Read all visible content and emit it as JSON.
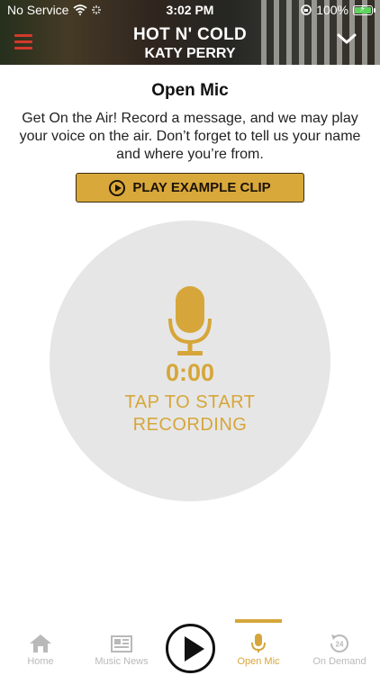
{
  "status_bar": {
    "carrier": "No Service",
    "time": "3:02 PM",
    "battery": "100%",
    "battery_level": 1.0
  },
  "now_playing": {
    "title": "HOT N' COLD",
    "artist": "KATY PERRY",
    "menu_icon": "hamburger-icon",
    "collapse_icon": "chevron-down-icon"
  },
  "open_mic": {
    "title": "Open Mic",
    "intro": "Get On the Air!  Record a message, and we may play your voice on the air.  Don’t forget to tell us your name and where you’re from.",
    "example_button": "PLAY EXAMPLE CLIP",
    "timer": "0:00",
    "tap_line1": "TAP TO START",
    "tap_line2": "RECORDING"
  },
  "tabs": [
    {
      "label": "Home",
      "icon": "home-icon"
    },
    {
      "label": "Music News",
      "icon": "newspaper-icon"
    },
    {
      "label": "Open Mic",
      "icon": "microphone-icon",
      "active": true
    },
    {
      "label": "On Demand",
      "icon": "24h-icon"
    }
  ],
  "colors": {
    "accent": "#d6a63a",
    "menu_red": "#d23a2c",
    "circle_bg": "#e6e6e6",
    "tab_inactive": "#b9b9b9"
  }
}
